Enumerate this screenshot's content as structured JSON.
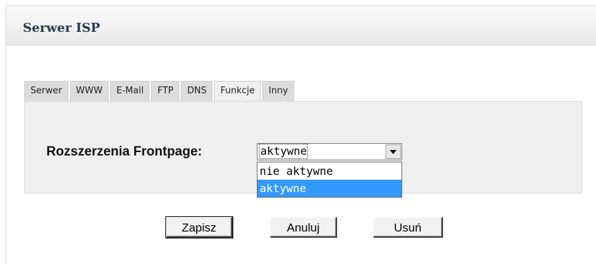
{
  "panel": {
    "title": "Serwer ISP"
  },
  "tabs": [
    {
      "label": "Serwer"
    },
    {
      "label": "WWW"
    },
    {
      "label": "E-Mail"
    },
    {
      "label": "FTP"
    },
    {
      "label": "DNS"
    },
    {
      "label": "Funkcje",
      "active": true
    },
    {
      "label": "Inny"
    }
  ],
  "form": {
    "frontpage_label": "Rozszerzenia Frontpage:",
    "frontpage_value": "aktywne",
    "options": [
      "nie aktywne",
      "aktywne"
    ],
    "selected_option": "aktywne"
  },
  "buttons": {
    "save": "Zapisz",
    "cancel": "Anuluj",
    "delete": "Usuń"
  },
  "colors": {
    "highlight": "#3399ff",
    "tab_active": "#efefef",
    "tab_inactive": "#dcdcdc",
    "title_text": "#25374d"
  }
}
